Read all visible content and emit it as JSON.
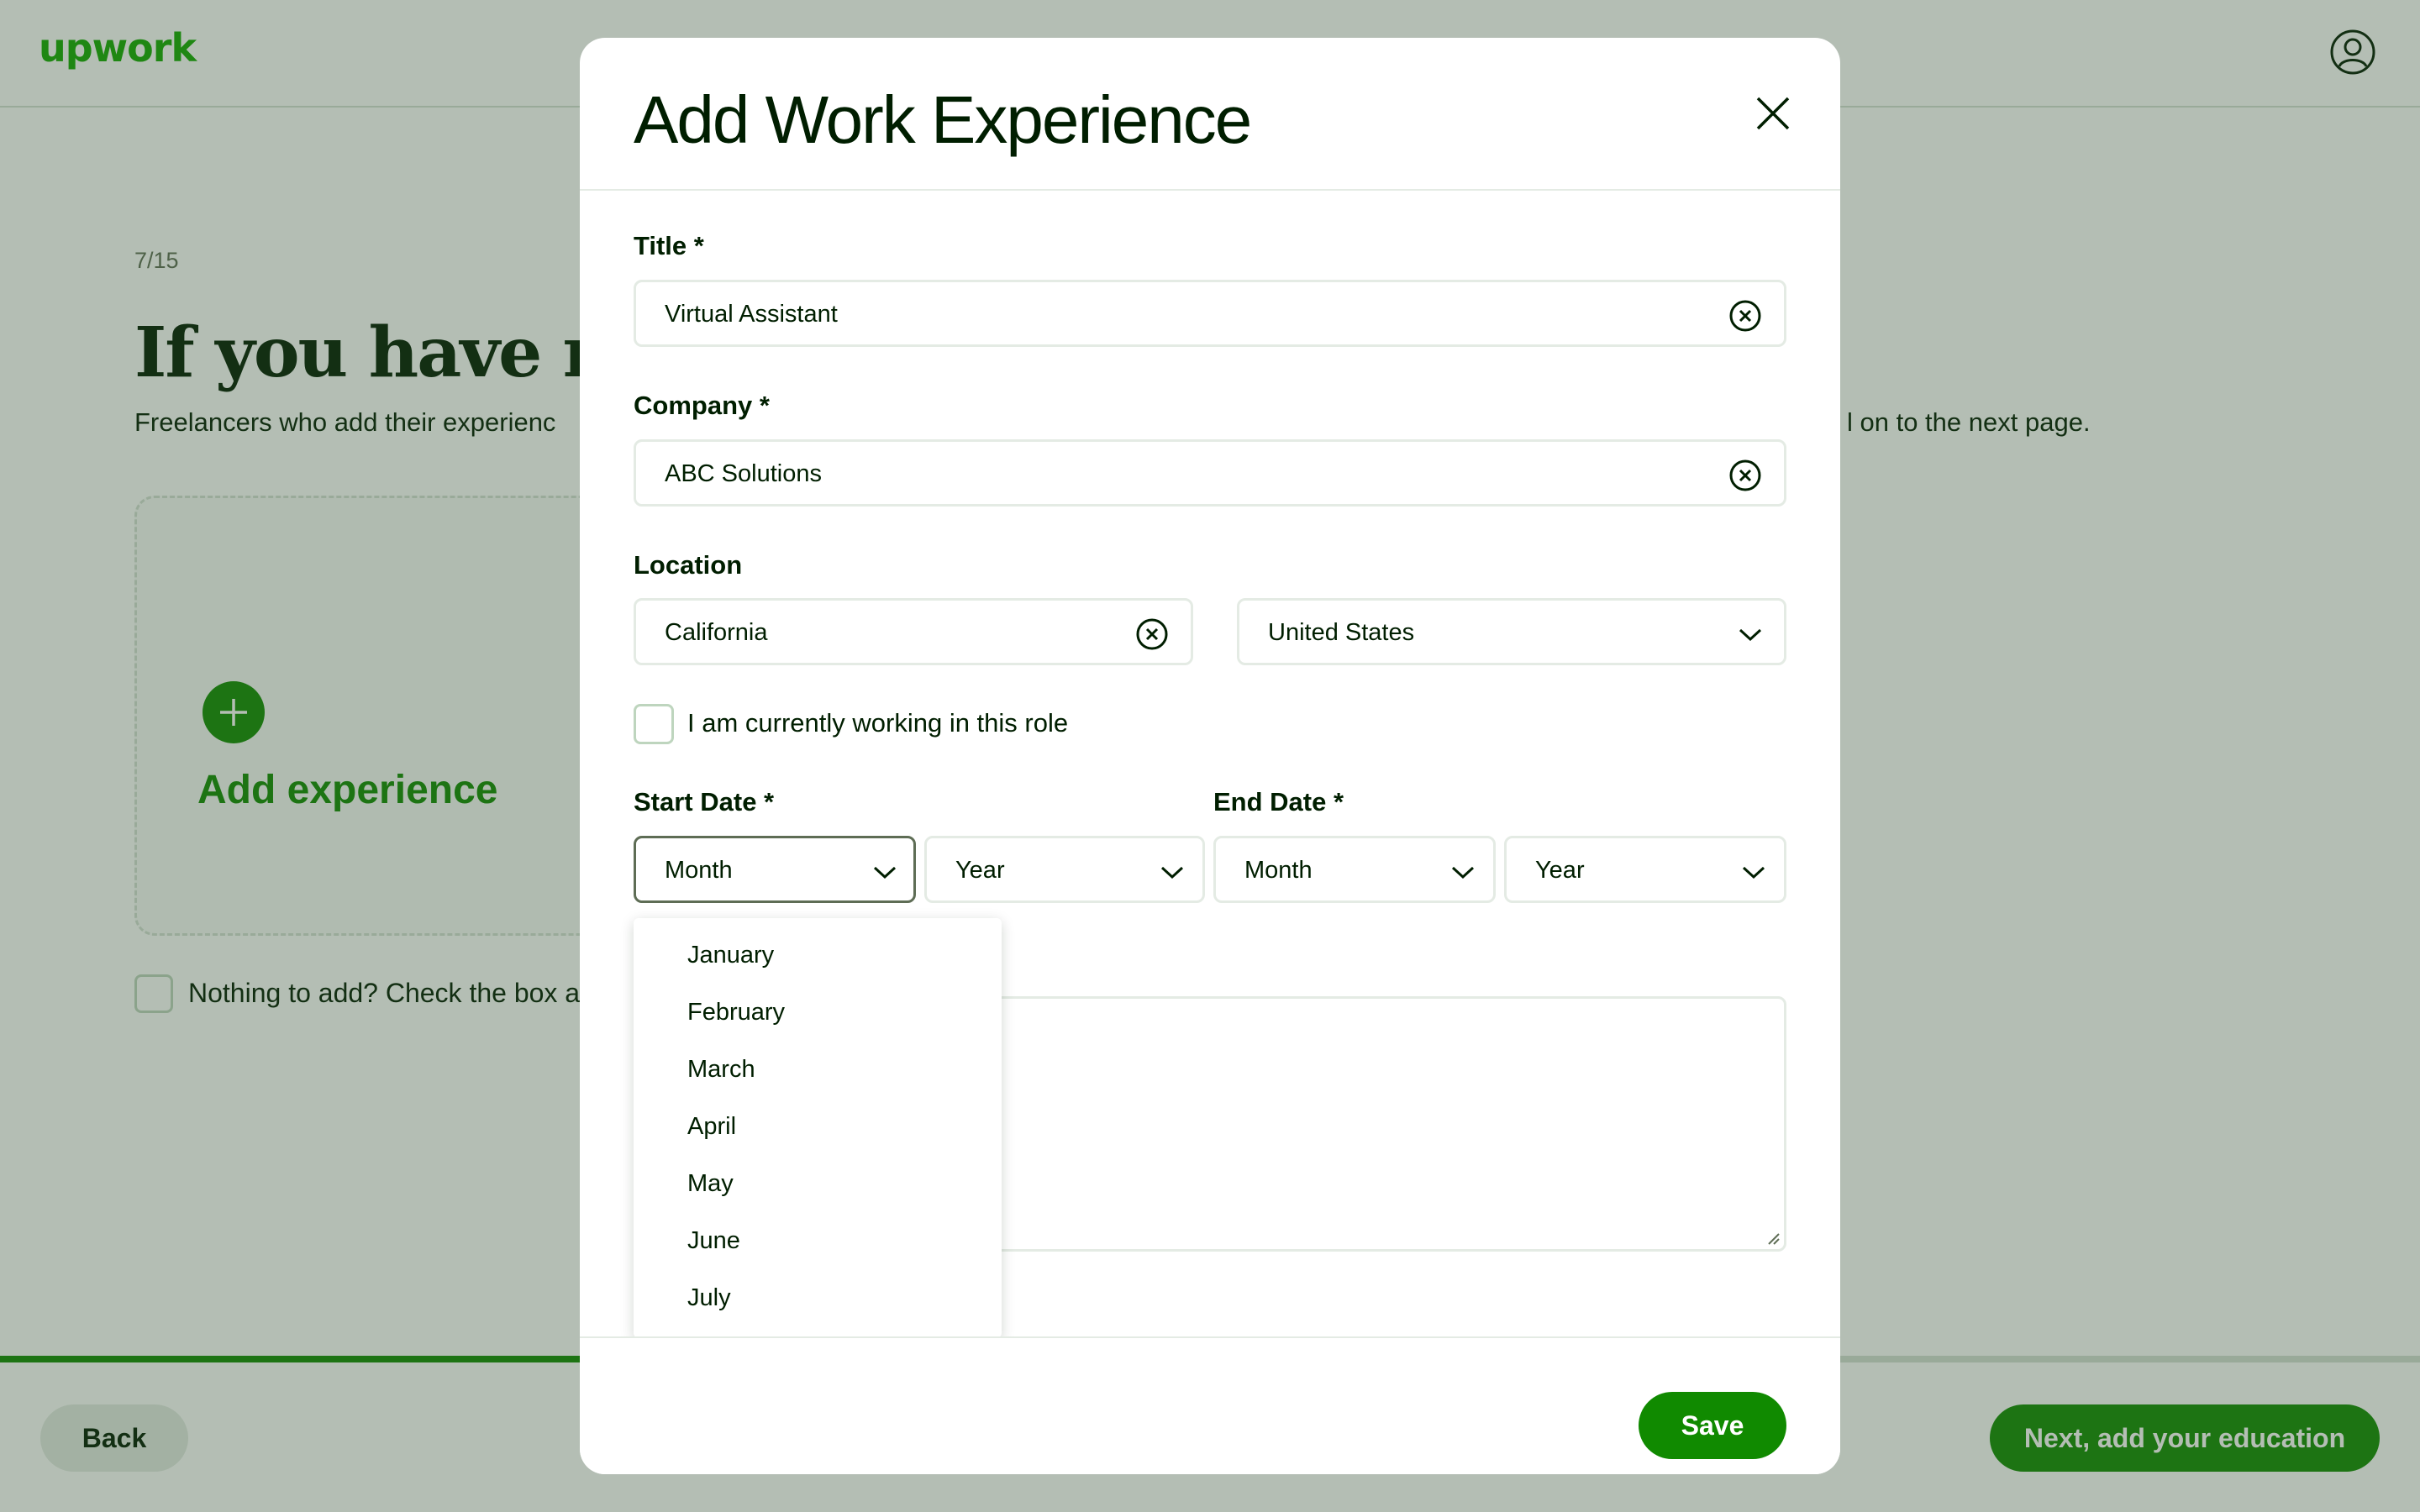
{
  "brand": {
    "logo_text": "upwork",
    "color": "#14a800"
  },
  "colors": {
    "accent": "#108a00",
    "text": "#001e00",
    "border": "#e4ebe4"
  },
  "onboarding": {
    "step": "7/15",
    "headline": "If you have rele",
    "subtext_left": "Freelancers who add their experienc",
    "subtext_right": "l on to the next page.",
    "add_experience_label": "Add experience",
    "nothing_to_add_label": "Nothing to add? Check the box a",
    "progress_fraction": 0.24,
    "back_label": "Back",
    "next_label": "Next, add your education"
  },
  "modal": {
    "title": "Add Work Experience",
    "fields": {
      "title": {
        "label": "Title *",
        "value": "Virtual Assistant"
      },
      "company": {
        "label": "Company *",
        "value": "ABC Solutions"
      },
      "location": {
        "label": "Location",
        "city_value": "California",
        "country_value": "United States"
      },
      "currently_working": {
        "label": "I am currently working in this role",
        "checked": false
      },
      "start_date": {
        "label": "Start Date *",
        "month": "Month",
        "year": "Year"
      },
      "end_date": {
        "label": "End Date *",
        "month": "Month",
        "year": "Year"
      }
    },
    "month_options": [
      "January",
      "February",
      "March",
      "April",
      "May",
      "June",
      "July"
    ],
    "save_label": "Save"
  }
}
